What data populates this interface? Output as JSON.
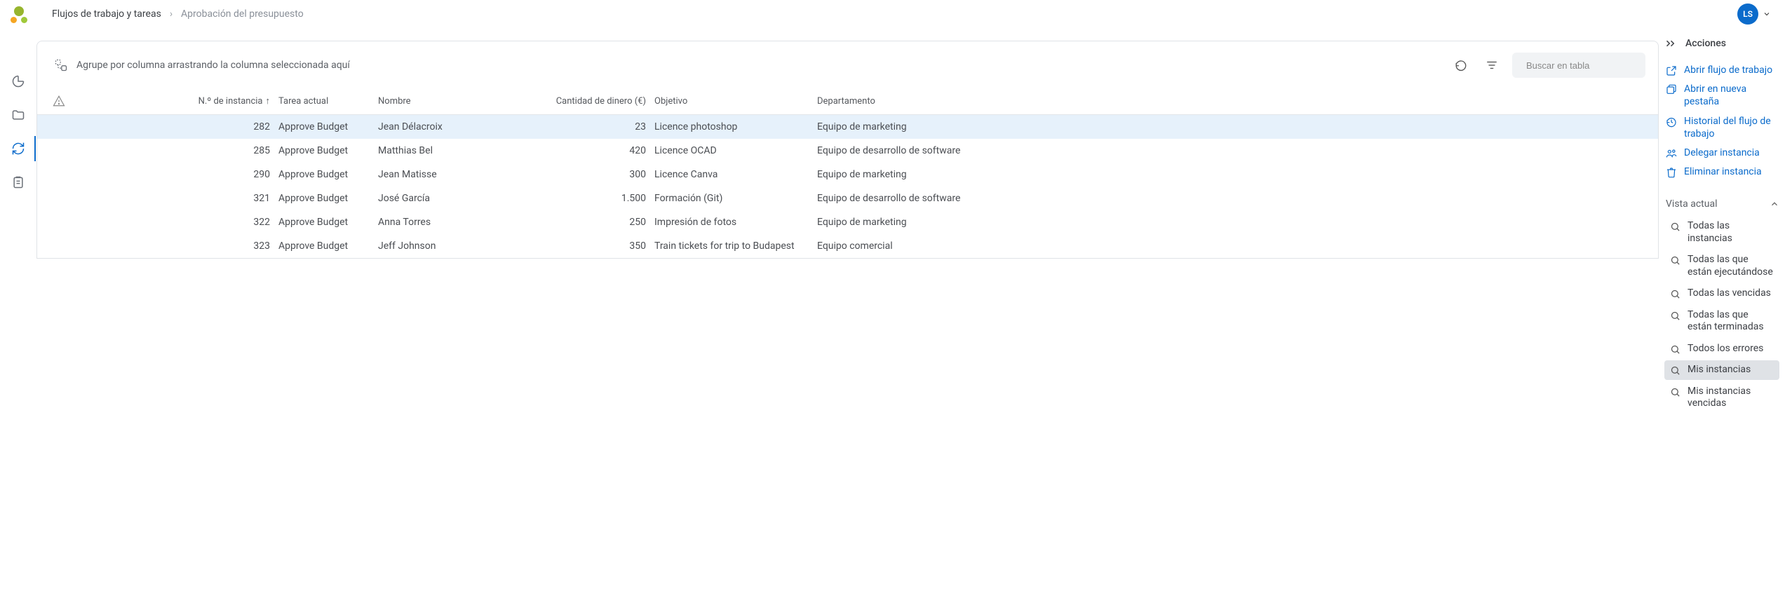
{
  "breadcrumb": {
    "root": "Flujos de trabajo y tareas",
    "current": "Aprobación del presupuesto"
  },
  "avatar": "LS",
  "toolbar": {
    "group_hint": "Agrupe por columna arrastrando la columna seleccionada aquí"
  },
  "search": {
    "placeholder": "Buscar en tabla"
  },
  "columns": {
    "instance_no": "N.º de instancia",
    "current_task": "Tarea actual",
    "name": "Nombre",
    "amount": "Cantidad de dinero (€)",
    "objective": "Objetivo",
    "department": "Departamento"
  },
  "rows": [
    {
      "no": "282",
      "task": "Approve Budget",
      "name": "Jean Délacroix",
      "amount": "23",
      "objective": "Licence photoshop",
      "dept": "Equipo de marketing",
      "selected": true
    },
    {
      "no": "285",
      "task": "Approve Budget",
      "name": "Matthias Bel",
      "amount": "420",
      "objective": "Licence OCAD",
      "dept": "Equipo de desarrollo de software",
      "selected": false
    },
    {
      "no": "290",
      "task": "Approve Budget",
      "name": "Jean Matisse",
      "amount": "300",
      "objective": "Licence Canva",
      "dept": "Equipo de marketing",
      "selected": false
    },
    {
      "no": "321",
      "task": "Approve Budget",
      "name": "José García",
      "amount": "1.500",
      "objective": "Formación (Git)",
      "dept": "Equipo de desarrollo de software",
      "selected": false
    },
    {
      "no": "322",
      "task": "Approve Budget",
      "name": "Anna Torres",
      "amount": "250",
      "objective": "Impresión de fotos",
      "dept": "Equipo de marketing",
      "selected": false
    },
    {
      "no": "323",
      "task": "Approve Budget",
      "name": "Jeff Johnson",
      "amount": "350",
      "objective": "Train tickets for trip to Budapest",
      "dept": "Equipo comercial",
      "selected": false
    }
  ],
  "rightpanel": {
    "title": "Acciones",
    "actions": [
      {
        "icon": "open-external",
        "label": "Abrir flujo de trabajo"
      },
      {
        "icon": "new-tab",
        "label": "Abrir en nueva pestaña"
      },
      {
        "icon": "history",
        "label": "Historial del flujo de trabajo"
      },
      {
        "icon": "delegate",
        "label": "Delegar instancia"
      },
      {
        "icon": "trash",
        "label": "Eliminar instancia"
      }
    ],
    "view_section": "Vista actual",
    "views": [
      {
        "label": "Todas las instancias",
        "active": false
      },
      {
        "label": "Todas las que están ejecutándose",
        "active": false
      },
      {
        "label": "Todas las vencidas",
        "active": false
      },
      {
        "label": "Todas las que están terminadas",
        "active": false
      },
      {
        "label": "Todos los errores",
        "active": false
      },
      {
        "label": "Mis instancias",
        "active": true
      },
      {
        "label": "Mis instancias vencidas",
        "active": false
      }
    ]
  }
}
